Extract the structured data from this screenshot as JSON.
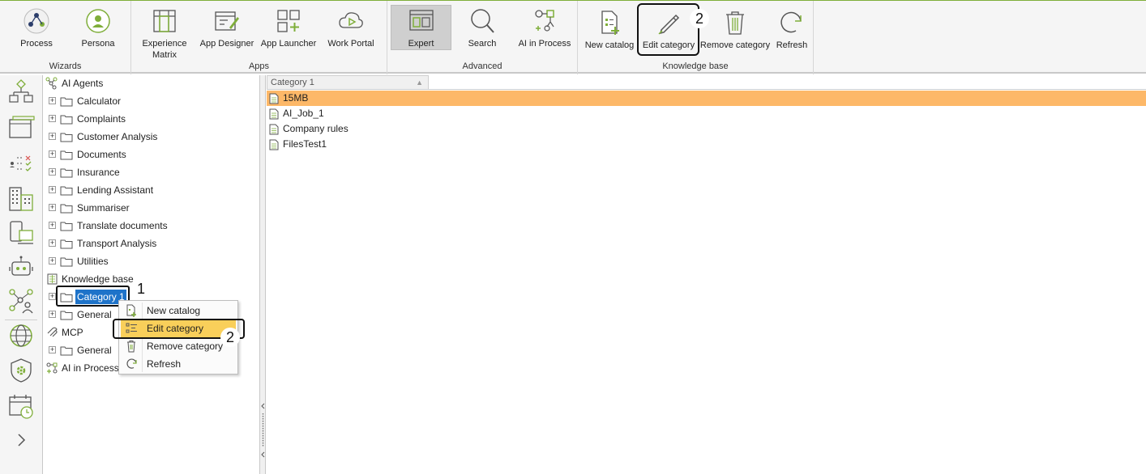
{
  "colors": {
    "accent": "#7fae3a",
    "selection_blue": "#1e73c9",
    "row_highlight": "#fdb868",
    "menu_highlight": "#f9cf5a"
  },
  "ribbon": {
    "groups": {
      "wizards": "Wizards",
      "apps": "Apps",
      "advanced": "Advanced",
      "knowledge_base": "Knowledge base"
    },
    "buttons": {
      "process": "Process",
      "persona": "Persona",
      "experience_matrix": "Experience Matrix",
      "app_designer": "App Designer",
      "app_launcher": "App Launcher",
      "work_portal": "Work Portal",
      "expert": "Expert",
      "search": "Search",
      "ai_in_process": "AI in Process",
      "new_catalog": "New catalog",
      "edit_category": "Edit category",
      "remove_category": "Remove category",
      "refresh": "Refresh"
    },
    "callout": "2"
  },
  "rail": {
    "icons": [
      "diagram-icon",
      "window-icon",
      "rules-icon",
      "buildings-icon",
      "devices-icon",
      "bot-icon",
      "network-person-icon",
      "globe-icon",
      "shield-gear-icon",
      "calendar-clock-icon",
      "chevron-right-icon"
    ]
  },
  "tree": {
    "ai_agents": "AI Agents",
    "ai_agents_children": [
      "Calculator",
      "Complaints",
      "Customer Analysis",
      "Documents",
      "Insurance",
      "Lending Assistant",
      "Summariser",
      "Translate documents",
      "Transport Analysis",
      "Utilities"
    ],
    "knowledge_base": "Knowledge base",
    "kb_children": [
      "Category 1",
      "General"
    ],
    "mcp": "MCP",
    "mcp_children": [
      "General"
    ],
    "ai_in_process": "AI in Process",
    "callout_1": "1",
    "callout_2": "2"
  },
  "list": {
    "header": "Category 1",
    "rows": [
      "15MB",
      "AI_Job_1",
      "Company rules",
      "FilesTest1"
    ]
  },
  "context_menu": {
    "items": [
      "New catalog",
      "Edit category",
      "Remove category",
      "Refresh"
    ]
  }
}
